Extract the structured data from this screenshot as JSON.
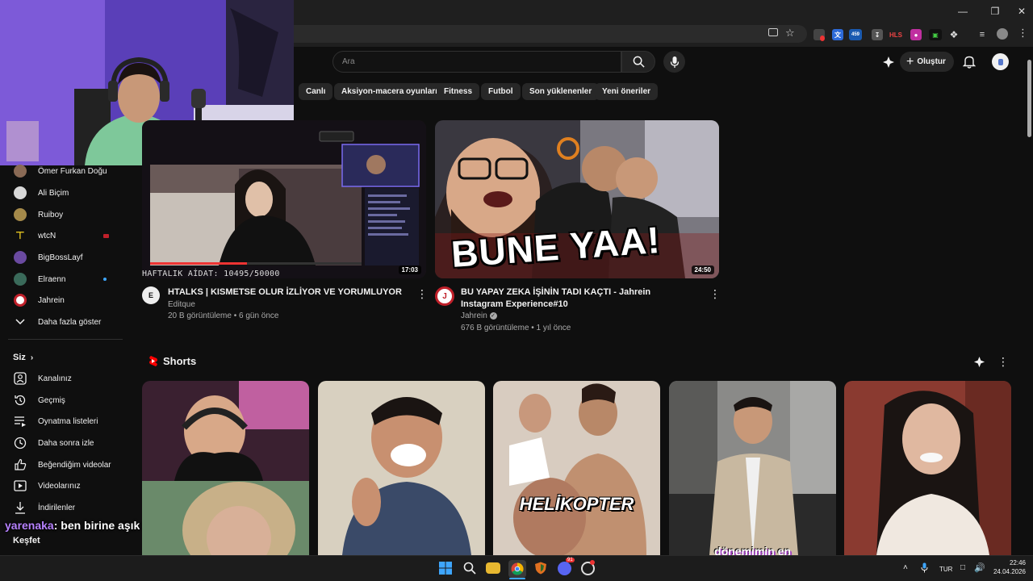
{
  "search": {
    "placeholder": "Ara"
  },
  "header": {
    "create_label": "Oluştur"
  },
  "chips": [
    "Canlı",
    "Aksiyon-macera oyunları",
    "Fitness",
    "Futbol",
    "Son yüklenenler",
    "Yeni öneriler"
  ],
  "sidebar": {
    "subscriptions": [
      {
        "label": "Ömer Furkan Doğu",
        "color": "#8a6a55"
      },
      {
        "label": "Ali Biçim",
        "color": "#d8d8d8"
      },
      {
        "label": "Ruiboy",
        "color": "#a58a4a"
      },
      {
        "label": "wtcN",
        "color": "#e0c020"
      },
      {
        "label": "BigBossLayf",
        "color": "#6a4aa0"
      },
      {
        "label": "Elraenn",
        "color": "#3a6a5a"
      },
      {
        "label": "Jahrein",
        "color": "#c0202a"
      }
    ],
    "show_more": "Daha fazla göster",
    "you_heading": "Siz",
    "you_items": [
      "Kanalınız",
      "Geçmiş",
      "Oynatma listeleri",
      "Daha sonra izle",
      "Beğendiğim videolar",
      "Videolarınız",
      "İndirilenler"
    ],
    "explore": "Keşfet"
  },
  "videos": [
    {
      "title": "HTALKS | KISMETSE OLUR İZLİYOR VE YORUMLUYOR",
      "channel": "Editque",
      "meta": "20 B görüntüleme • 6 gün önce",
      "duration": "17:03",
      "overlay_text": "HAFTALIK AİDAT: 10495/50000"
    },
    {
      "title": "BU YAPAY ZEKA İŞİNİN TADI KAÇTI - Jahrein Instagram Experience#10",
      "channel": "Jahrein",
      "meta": "676 B görüntüleme • 1 yıl önce",
      "duration": "24:50",
      "overlay_text": "BUNE YAA!"
    }
  ],
  "shorts": {
    "heading": "Shorts",
    "items": [
      {
        "caption": "",
        "bg": "#3a2030"
      },
      {
        "caption": "",
        "bg": "#b8a890"
      },
      {
        "caption": "HELİKOPTER",
        "bg": "#c8b8a8"
      },
      {
        "caption": "",
        "bg": "#6a6a68"
      },
      {
        "caption": "",
        "bg": "#8a3a30"
      }
    ],
    "bottom_caption": "dönemimin en"
  },
  "chat": {
    "user": "yarenaka",
    "message": ": ben birine aşık oldum ama gay"
  },
  "taskbar": {
    "lang": "TUR",
    "time": "22:46",
    "date": "24.04.2026",
    "discord_badge": "91"
  },
  "extensions": {
    "badge": "459",
    "hls": "HLS"
  },
  "accent": "#ff0000"
}
